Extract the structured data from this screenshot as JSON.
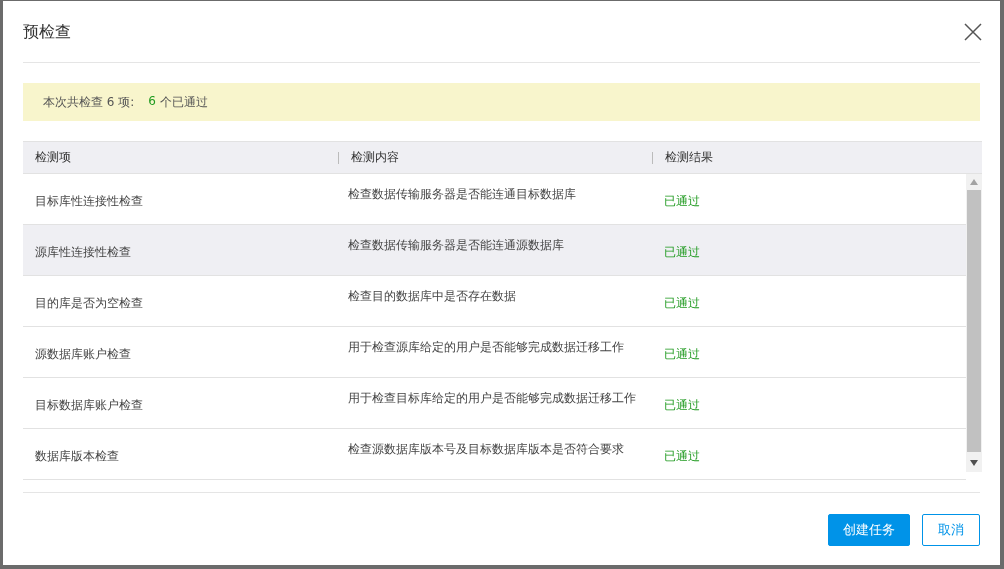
{
  "dialog": {
    "title": "预检查"
  },
  "summary": {
    "total_text": "本次共检查 6 项:",
    "passed_count": "6",
    "passed_text": "个已通过"
  },
  "table": {
    "columns": [
      "检测项",
      "检测内容",
      "检测结果"
    ],
    "rows": [
      {
        "item": "目标库性连接性检查",
        "content": "检查数据传输服务器是否能连通目标数据库",
        "result": "已通过",
        "selected": false
      },
      {
        "item": "源库性连接性检查",
        "content": "检查数据传输服务器是否能连通源数据库",
        "result": "已通过",
        "selected": true
      },
      {
        "item": "目的库是否为空检查",
        "content": "检查目的数据库中是否存在数据",
        "result": "已通过",
        "selected": false
      },
      {
        "item": "源数据库账户检查",
        "content": "用于检查源库给定的用户是否能够完成数据迁移工作",
        "result": "已通过",
        "selected": false
      },
      {
        "item": "目标数据库账户检查",
        "content": "用于检查目标库给定的用户是否能够完成数据迁移工作",
        "result": "已通过",
        "selected": false
      },
      {
        "item": "数据库版本检查",
        "content": "检查源数据库版本号及目标数据库版本是否符合要求",
        "result": "已通过",
        "selected": false
      }
    ]
  },
  "buttons": [
    {
      "label": "创建任务",
      "kind": "primary"
    },
    {
      "label": "取消",
      "kind": "secondary"
    }
  ]
}
